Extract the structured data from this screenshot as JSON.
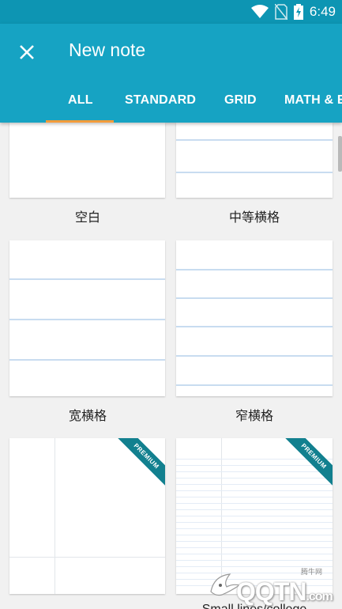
{
  "status_bar": {
    "time": "6:49"
  },
  "header": {
    "title": "New note"
  },
  "tabs": [
    {
      "label": "ALL"
    },
    {
      "label": "STANDARD"
    },
    {
      "label": "GRID"
    },
    {
      "label": "MATH & E"
    }
  ],
  "templates": [
    {
      "label": "空白"
    },
    {
      "label": "中等横格"
    },
    {
      "label": "宽横格"
    },
    {
      "label": "窄横格"
    },
    {
      "ribbon": "PREMIUM"
    },
    {
      "ribbon": "PREMIUM",
      "label": "Small lines/college"
    }
  ],
  "watermark": {
    "brand": "QQTN",
    "sub": "腾牛网",
    "suffix": ".com"
  },
  "colors": {
    "accent": "#16a3c3",
    "status": "#0d95b3",
    "indicator": "#f39c3a",
    "ribbon": "#12808f"
  }
}
